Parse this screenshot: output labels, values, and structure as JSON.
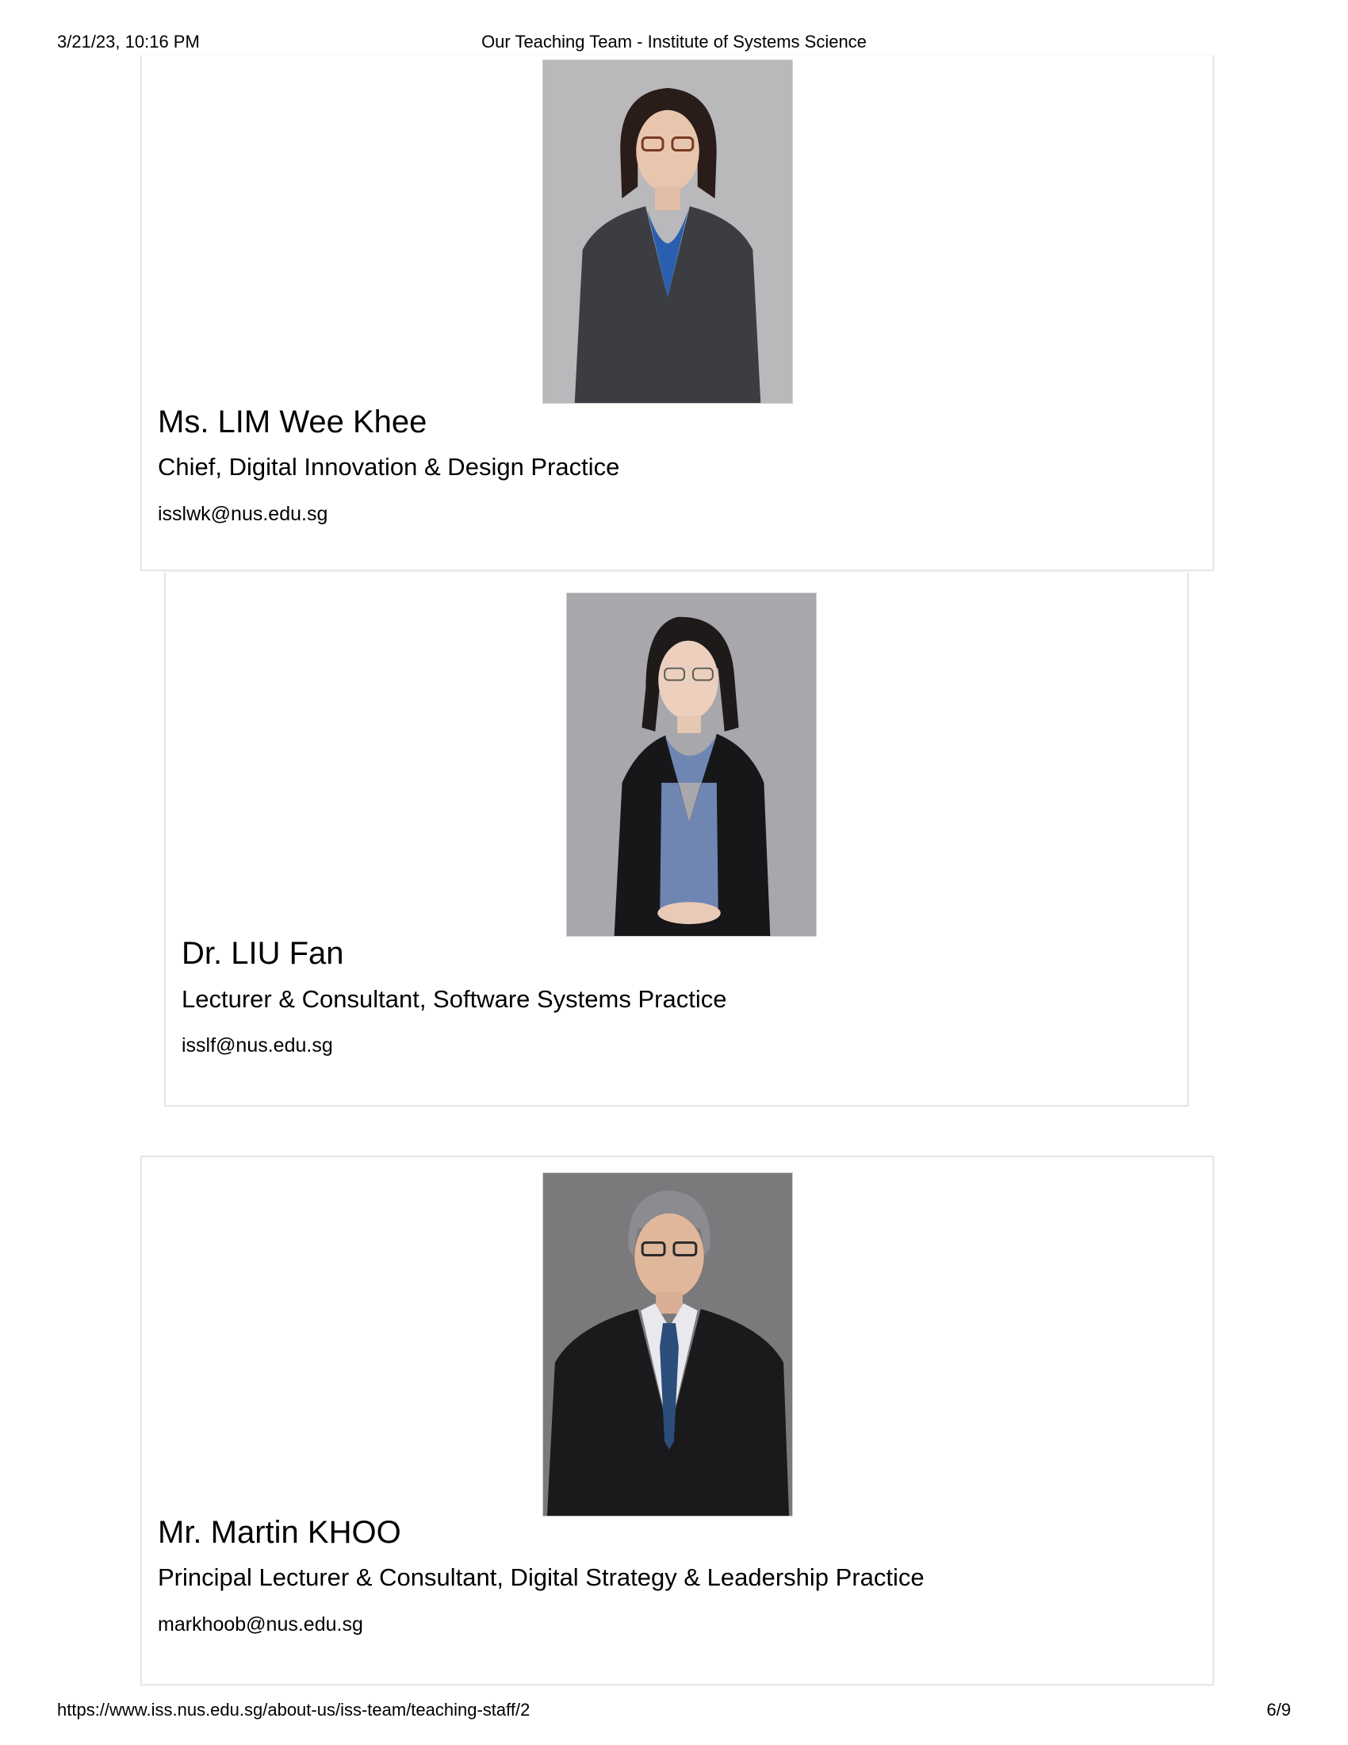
{
  "header": {
    "datetime": "3/21/23, 10:16 PM",
    "title": "Our Teaching Team - Institute of Systems Science"
  },
  "staff": [
    {
      "name": "Ms. LIM Wee Khee",
      "role": "Chief, Digital Innovation & Design Practice",
      "email": "isslwk@nus.edu.sg"
    },
    {
      "name": "Dr. LIU Fan",
      "role": "Lecturer & Consultant, Software Systems Practice",
      "email": "isslf@nus.edu.sg"
    },
    {
      "name": "Mr. Martin KHOO",
      "role": "Principal Lecturer & Consultant, Digital Strategy & Leadership Practice",
      "email": "markhoob@nus.edu.sg"
    }
  ],
  "footer": {
    "url": "https://www.iss.nus.edu.sg/about-us/iss-team/teaching-staff/2",
    "page": "6/9"
  },
  "colors": {
    "photo_bg_lim": "#b9b8bb",
    "photo_bg_liu": "#a8a7ac",
    "photo_bg_khoo": "#7a797c",
    "card_border": "#e6e6e6"
  }
}
